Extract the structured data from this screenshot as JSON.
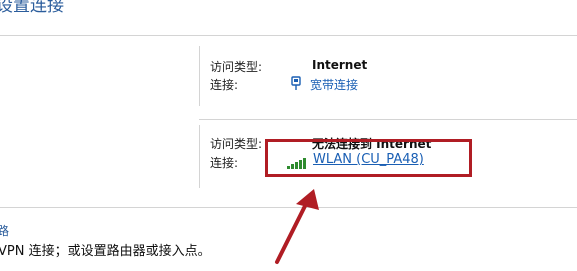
{
  "header": {
    "title": "设置连接"
  },
  "networks": [
    {
      "access_type_label": "访问类型:",
      "access_type_value": "Internet",
      "connection_label": "连接:",
      "connection_name": "宽带连接",
      "connection_icon": "ethernet-icon"
    },
    {
      "access_type_label": "访问类型:",
      "access_type_value": "无法连接到 Internet",
      "connection_label": "连接:",
      "connection_name": "WLAN (CU_PA48)",
      "connection_icon": "wifi-signal-icon"
    }
  ],
  "change_settings": {
    "item_title": "路",
    "item_desc": "VPN 连接；或设置路由器或接入点。"
  },
  "colors": {
    "link": "#1a5fb4",
    "highlight": "#b01d24",
    "signal": "#2e8b2e"
  }
}
